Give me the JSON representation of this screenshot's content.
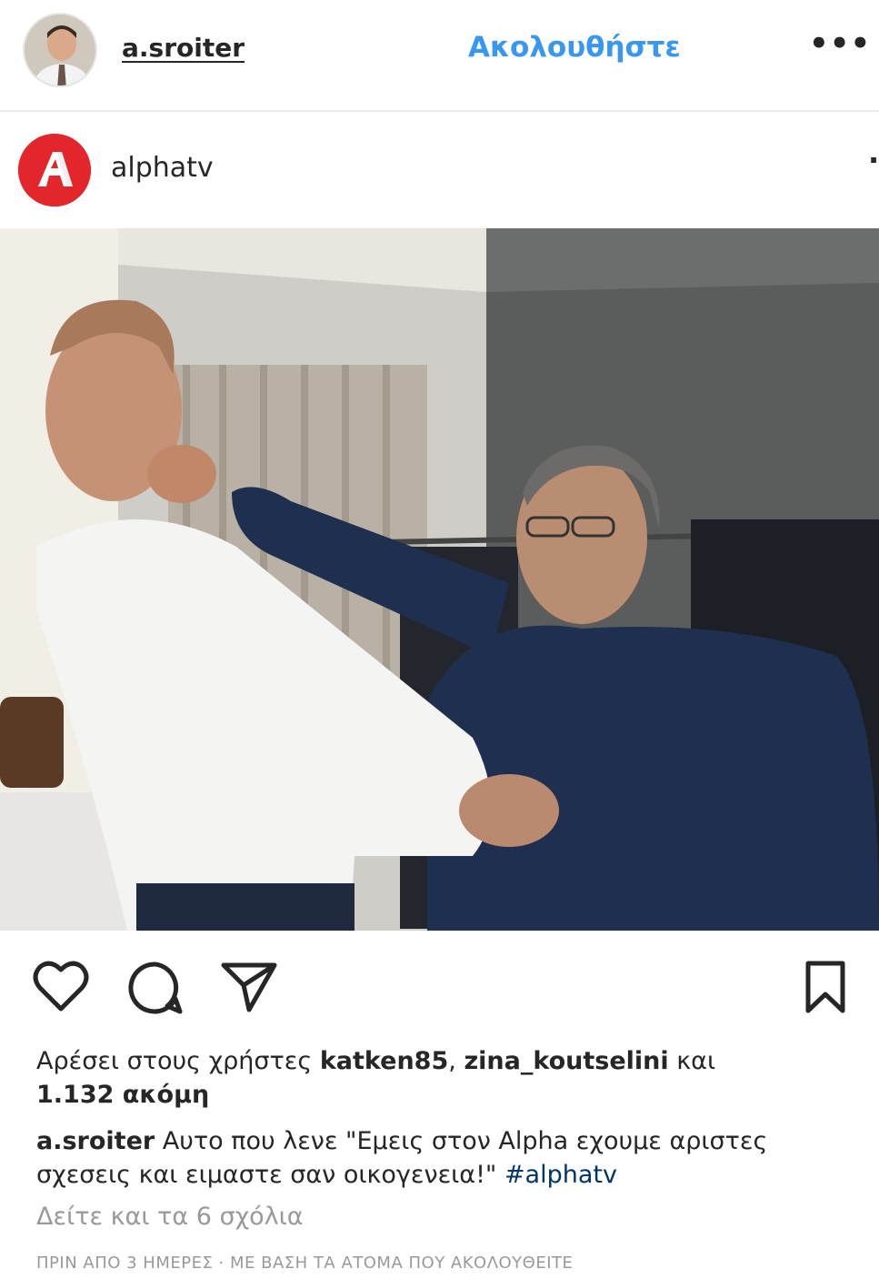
{
  "header": {
    "username": "a.sroiter",
    "follow_label": "Ακολουθήστε",
    "more_icon": "more-dots-icon"
  },
  "shared_post": {
    "username": "alphatv",
    "logo_letter": "A",
    "logo_color": "#e3262b"
  },
  "actions": {
    "icons": [
      "heart-icon",
      "comment-icon",
      "share-icon",
      "bookmark-icon"
    ]
  },
  "likes": {
    "prefix": "Αρέσει στους χρήστες",
    "user1": "katken85",
    "separator": ",",
    "user2": "zina_koutselini",
    "conjunction": "και",
    "more": "1.132 ακόμη"
  },
  "caption": {
    "username": "a.sroiter",
    "text": "Αυτο που λενε \"Εμεις στον Alpha εχουμε αριστες σχεσεις και ειμαστε σαν οικογενεια!\"",
    "hashtag": "#alphatv"
  },
  "comments": {
    "view_all": "Δείτε και τα 6 σχόλια"
  },
  "timestamp": "ΠΡΙΝ ΑΠΟ 3 ΗΜΕΡΕΣ · ΜΕ ΒΑΣΗ ΤΑ ΑΤΟΜΑ ΠΟΥ ΑΚΟΛΟΥΘΕΙΤΕ",
  "colors": {
    "link_blue": "#3897f0",
    "hashtag_blue": "#003569",
    "muted": "#999999",
    "text": "#262626"
  }
}
